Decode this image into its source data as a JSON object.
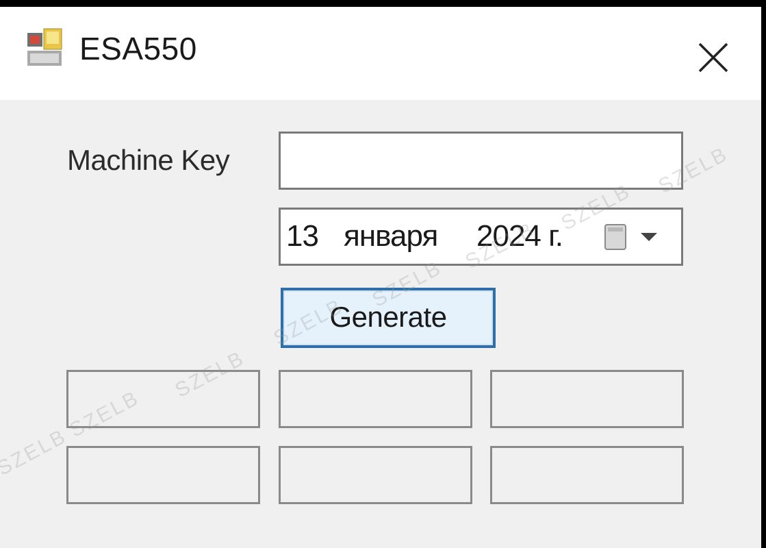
{
  "window": {
    "title": "ESA550",
    "icon": "application-icon",
    "close_icon": "close-icon"
  },
  "form": {
    "machine_key_label": "Machine Key",
    "machine_key_value": "",
    "date": {
      "day": "13",
      "month": "января",
      "year": "2024 г.",
      "dropdown_icon": "calendar-dropdown-icon"
    },
    "generate_label": "Generate",
    "outputs": [
      [
        "",
        "",
        ""
      ],
      [
        "",
        "",
        ""
      ]
    ]
  },
  "watermark": "SZELB",
  "colors": {
    "titlebar": "#ffffff",
    "client": "#f0f0f0",
    "button_border": "#2f6fa8",
    "button_fill": "#e5f1fb"
  }
}
